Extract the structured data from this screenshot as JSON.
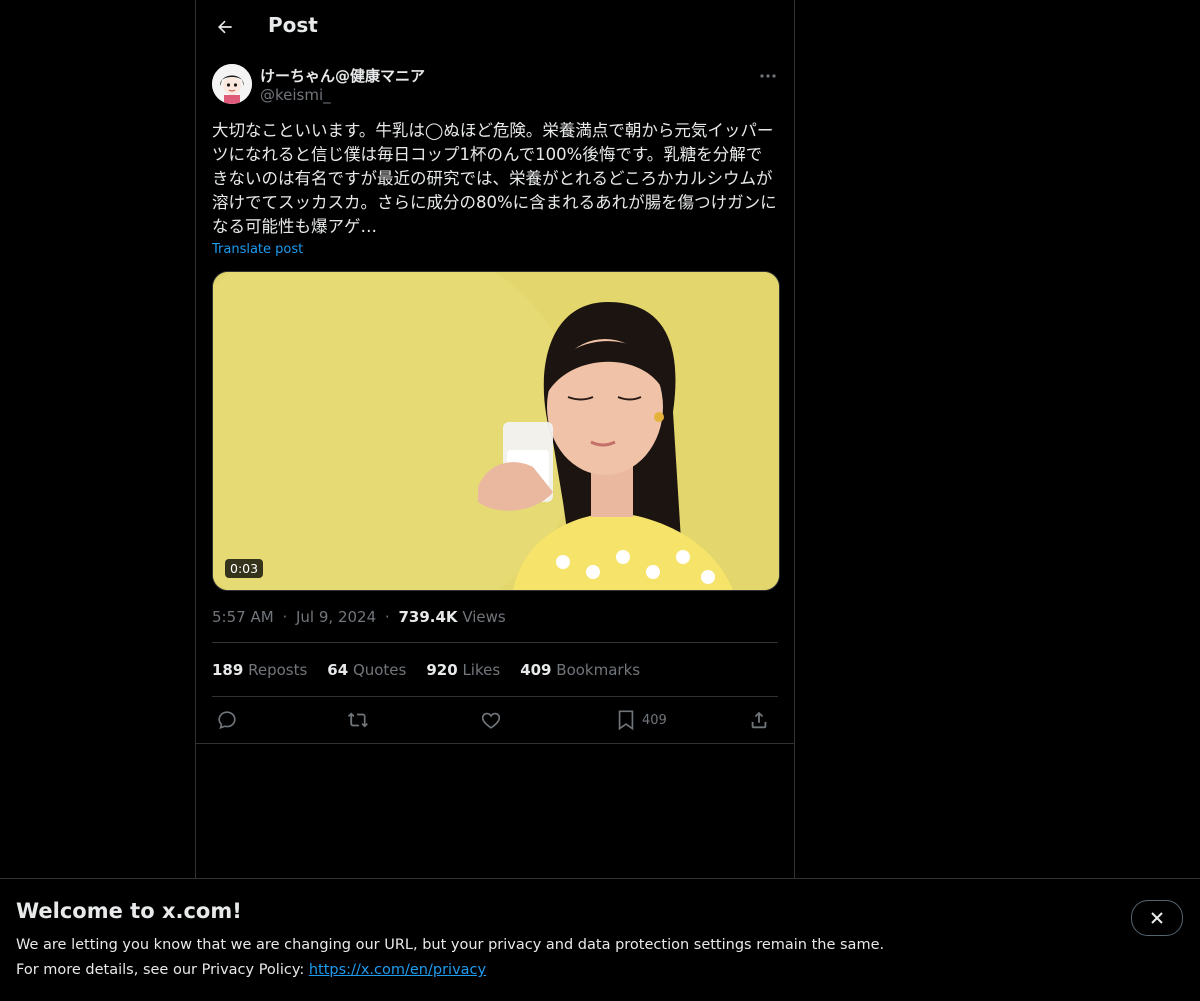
{
  "header": {
    "title": "Post",
    "back_icon": "arrow-left-icon"
  },
  "author": {
    "name": "けーちゃん@健康マニア",
    "handle": "@keismi_"
  },
  "post": {
    "text": "大切なこといいます。牛乳は◯ぬほど危険。栄養満点で朝から元気イッパーツになれると信じ僕は毎日コップ1杯のんで100%後悔です。乳糖を分解できないのは有名ですが最近の研究では、栄養がとれるどころかカルシウムが溶けでてスッカスカ。さらに成分の80%に含まれるあれが腸を傷つけガンになる可能性も爆アゲ…",
    "translate_label": "Translate post",
    "media_duration": "0:03"
  },
  "meta": {
    "time": "5:57 AM",
    "date": "Jul 9, 2024",
    "views_count": "739.4K",
    "views_label": "Views",
    "separator": "·"
  },
  "stats": [
    {
      "count": "189",
      "label": "Reposts"
    },
    {
      "count": "64",
      "label": "Quotes"
    },
    {
      "count": "920",
      "label": "Likes"
    },
    {
      "count": "409",
      "label": "Bookmarks"
    }
  ],
  "actions": {
    "reply_icon": "reply-icon",
    "repost_icon": "repost-icon",
    "like_icon": "heart-icon",
    "bookmark_icon": "bookmark-icon",
    "bookmark_count": "409",
    "share_icon": "share-icon"
  },
  "banner": {
    "title": "Welcome to x.com!",
    "line1": "We are letting you know that we are changing our URL, but your privacy and data protection settings remain the same.",
    "line2_prefix": "For more details, see our Privacy Policy: ",
    "link": "https://x.com/en/privacy"
  },
  "colors": {
    "accent": "#1d9bf0",
    "background": "#000000",
    "text": "#e7e9ea",
    "muted": "#71767b",
    "border": "#2f3336"
  }
}
